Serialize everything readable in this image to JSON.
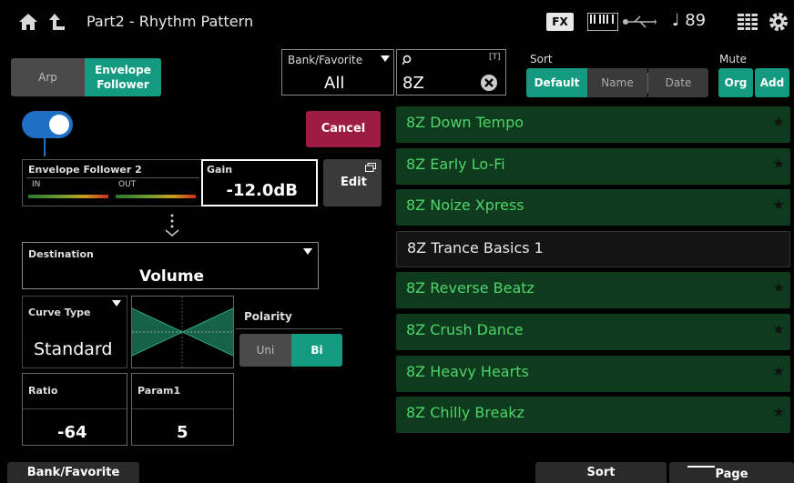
{
  "header": {
    "title": "Part2 - Rhythm Pattern",
    "fx_badge": "FX",
    "tempo": "♩ 89"
  },
  "arp_toggle": {
    "arp_label": "Arp",
    "env_label_1": "Envelope",
    "env_label_2": "Follower",
    "selected": "Envelope Follower"
  },
  "bank": {
    "label": "Bank/Favorite",
    "value": "All"
  },
  "search": {
    "badge": "[T]",
    "value": "8Z"
  },
  "sort": {
    "label": "Sort",
    "options": [
      "Default",
      "Name",
      "Date"
    ],
    "selected": "Default"
  },
  "mute": {
    "label": "Mute",
    "options": [
      "Org",
      "Add"
    ]
  },
  "envelope": {
    "enabled": true,
    "cancel_label": "Cancel",
    "title": "Envelope Follower 2",
    "in_label": "IN",
    "out_label": "OUT",
    "gain_label": "Gain",
    "gain_value": "-12.0dB",
    "edit_label": "Edit",
    "destination_label": "Destination",
    "destination_value": "Volume",
    "curve_type_label": "Curve Type",
    "curve_type_value": "Standard",
    "polarity_label": "Polarity",
    "polarity_options": [
      "Uni",
      "Bi"
    ],
    "polarity_selected": "Bi",
    "ratio_label": "Ratio",
    "ratio_value": "-64",
    "param1_label": "Param1",
    "param1_value": "5"
  },
  "patterns": [
    {
      "name": "8Z Down Tempo",
      "selected": false
    },
    {
      "name": "8Z Early Lo-Fi",
      "selected": false
    },
    {
      "name": "8Z Noize Xpress",
      "selected": false
    },
    {
      "name": "8Z Trance Basics 1",
      "selected": true
    },
    {
      "name": "8Z Reverse Beatz",
      "selected": false
    },
    {
      "name": "8Z Crush Dance",
      "selected": false
    },
    {
      "name": "8Z Heavy Hearts",
      "selected": false
    },
    {
      "name": "8Z Chilly Breakz",
      "selected": false
    }
  ],
  "bottom": {
    "bank_tab": "Bank/Favorite",
    "sort_tab": "Sort",
    "page_tab": "Page"
  },
  "colors": {
    "accent": "#149a80",
    "cancel": "#9c1c43",
    "list_bg": "#0e3a1e",
    "list_text": "#4fd46a",
    "toggle": "#1f70c4"
  }
}
